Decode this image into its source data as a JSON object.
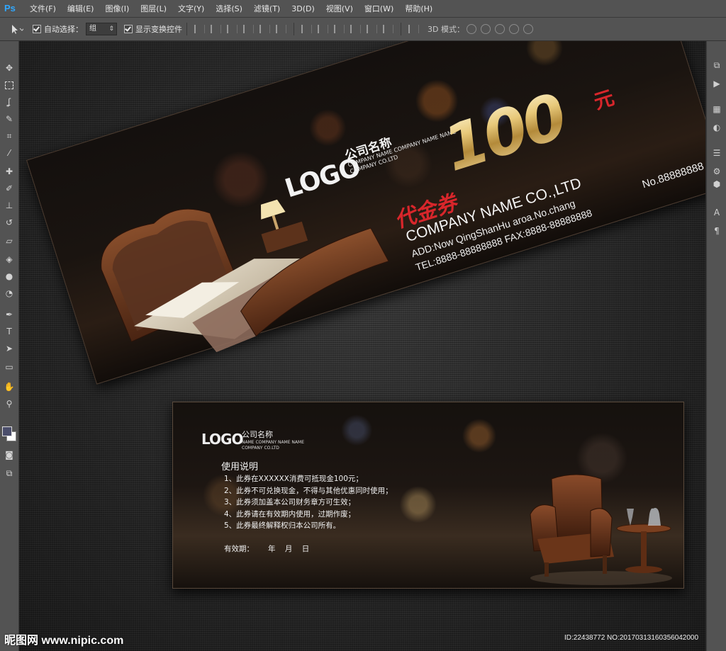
{
  "app": {
    "logo": "Ps",
    "accent": "#31a8ff"
  },
  "menu": [
    "文件(F)",
    "编辑(E)",
    "图像(I)",
    "图层(L)",
    "文字(Y)",
    "选择(S)",
    "滤镜(T)",
    "3D(D)",
    "视图(V)",
    "窗口(W)",
    "帮助(H)"
  ],
  "options": {
    "auto_select_label": "自动选择：",
    "auto_select_value": "组",
    "show_transform_label": "显示变换控件",
    "mode_3d_label": "3D 模式："
  },
  "voucher_front": {
    "logo": "LOGO",
    "company_cn": "公司名称",
    "company_sub": "COMPANY NAME COMPANY NAME NAME COMPANY CO.LTD",
    "amount": "100",
    "unit": "元",
    "title": "代金券",
    "company_en": "COMPANY NAME CO.,LTD",
    "address": "ADD:Now QingShanHu aroa.No.chang",
    "tel_fax": "TEL:8888-88888888  FAX:8888-88888888",
    "serial": "No.88888888",
    "amount_color": "#e8c97a",
    "title_color": "#d8262b"
  },
  "voucher_back": {
    "logo": "LOGO",
    "company_cn": "公司名称",
    "company_sub": "NAME COMPANY NAME NAME COMPANY CO.LTD",
    "instructions_title": "使用说明",
    "rules": [
      "1、此券在XXXXXX消费可抵现金100元；",
      "2、此券不可兑换现金，不得与其他优惠同时使用；",
      "3、此券须加盖本公司财务章方可生效；",
      "4、此券请在有效期内使用，过期作废；",
      "5、此券最终解释权归本公司所有。"
    ],
    "validity": "有效期：      年    月    日"
  },
  "watermark": {
    "left": "昵图网 www.nipic.com",
    "right": "ID:22438772 NO:20170313160356042000"
  },
  "icons": {
    "tools": [
      "move-tool-icon",
      "marquee-tool-icon",
      "lasso-tool-icon",
      "quick-select-icon",
      "crop-tool-icon",
      "eyedropper-icon",
      "healing-brush-icon",
      "brush-tool-icon",
      "clone-stamp-icon",
      "history-brush-icon",
      "eraser-icon",
      "paint-bucket-icon",
      "blur-tool-icon",
      "dodge-tool-icon",
      "pen-tool-icon",
      "type-tool-icon",
      "path-select-icon",
      "shape-tool-icon",
      "hand-tool-icon",
      "zoom-tool-icon"
    ],
    "dock": [
      "history-icon",
      "play-actions-icon",
      "swatches-icon",
      "adjustments-icon",
      "layers-icon",
      "channels-icon",
      "3d-icon",
      "character-icon",
      "paragraph-icon"
    ]
  }
}
